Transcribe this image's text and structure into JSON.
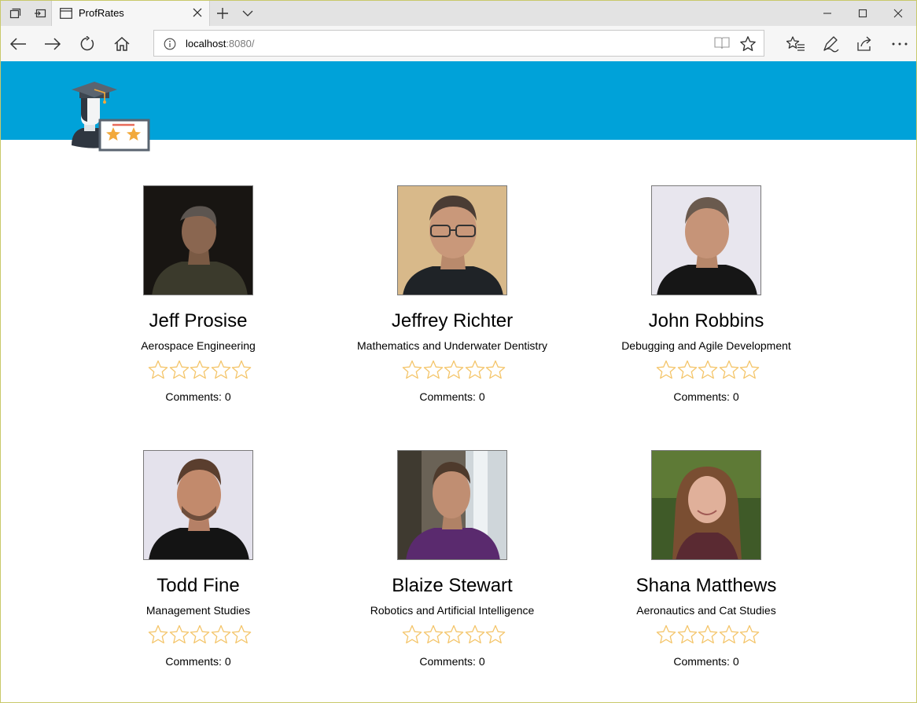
{
  "browser": {
    "tab_title": "ProfRates",
    "url_host": "localhost",
    "url_rest": ":8080/"
  },
  "colors": {
    "banner": "#00a2d9",
    "star_outline": "#f4c56a"
  },
  "profiles": [
    {
      "name": "Jeff Prosise",
      "subject": "Aerospace Engineering",
      "rating": 0,
      "comments_label": "Comments:",
      "comments": "0"
    },
    {
      "name": "Jeffrey Richter",
      "subject": "Mathematics and Underwater Dentistry",
      "rating": 0,
      "comments_label": "Comments:",
      "comments": "0"
    },
    {
      "name": "John Robbins",
      "subject": "Debugging and Agile Development",
      "rating": 0,
      "comments_label": "Comments:",
      "comments": "0"
    },
    {
      "name": "Todd Fine",
      "subject": "Management Studies",
      "rating": 0,
      "comments_label": "Comments:",
      "comments": "0"
    },
    {
      "name": "Blaize Stewart",
      "subject": "Robotics and Artificial Intelligence",
      "rating": 0,
      "comments_label": "Comments:",
      "comments": "0"
    },
    {
      "name": "Shana Matthews",
      "subject": "Aeronautics and Cat Studies",
      "rating": 0,
      "comments_label": "Comments:",
      "comments": "0"
    }
  ]
}
